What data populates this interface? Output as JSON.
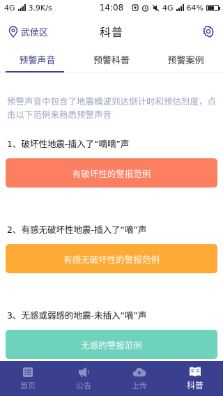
{
  "status_bar": {
    "network": "4G",
    "speed": "3.9K/s",
    "time": "14:08",
    "network_right": "4G",
    "battery": "64%",
    "battery_level": 0.64
  },
  "header": {
    "location": "武侯区",
    "title": "科普"
  },
  "tabs": [
    {
      "label": "预警声音",
      "active": true
    },
    {
      "label": "预警科普",
      "active": false
    },
    {
      "label": "预警案例",
      "active": false
    }
  ],
  "intro": "预警声音中包含了地震横波到达倒计时和预估烈度，点击以下范例来熟悉预警声音",
  "sections": [
    {
      "title": "1、破坏性地震-插入了“嘀嘀”声",
      "button": "有破坏性的警报范例",
      "color": "#fd7f62"
    },
    {
      "title": "2、有感无破坏性地震-插入了“嘀”声",
      "button": "有感无破坏性的警报范例",
      "color": "#fdab36"
    },
    {
      "title": "3、无感或弱感的地震-未插入“嘀”声",
      "button": "无感的警报范例",
      "color": "#6fd2bd"
    }
  ],
  "bottom_nav": [
    {
      "label": "首页",
      "icon": "list-icon",
      "active": false
    },
    {
      "label": "公告",
      "icon": "megaphone-icon",
      "active": false
    },
    {
      "label": "上传",
      "icon": "cloud-upload-icon",
      "active": false
    },
    {
      "label": "科普",
      "icon": "book-icon",
      "active": true
    }
  ],
  "colors": {
    "accent": "#3b3f8f",
    "intro_text": "#9aa3c2"
  }
}
